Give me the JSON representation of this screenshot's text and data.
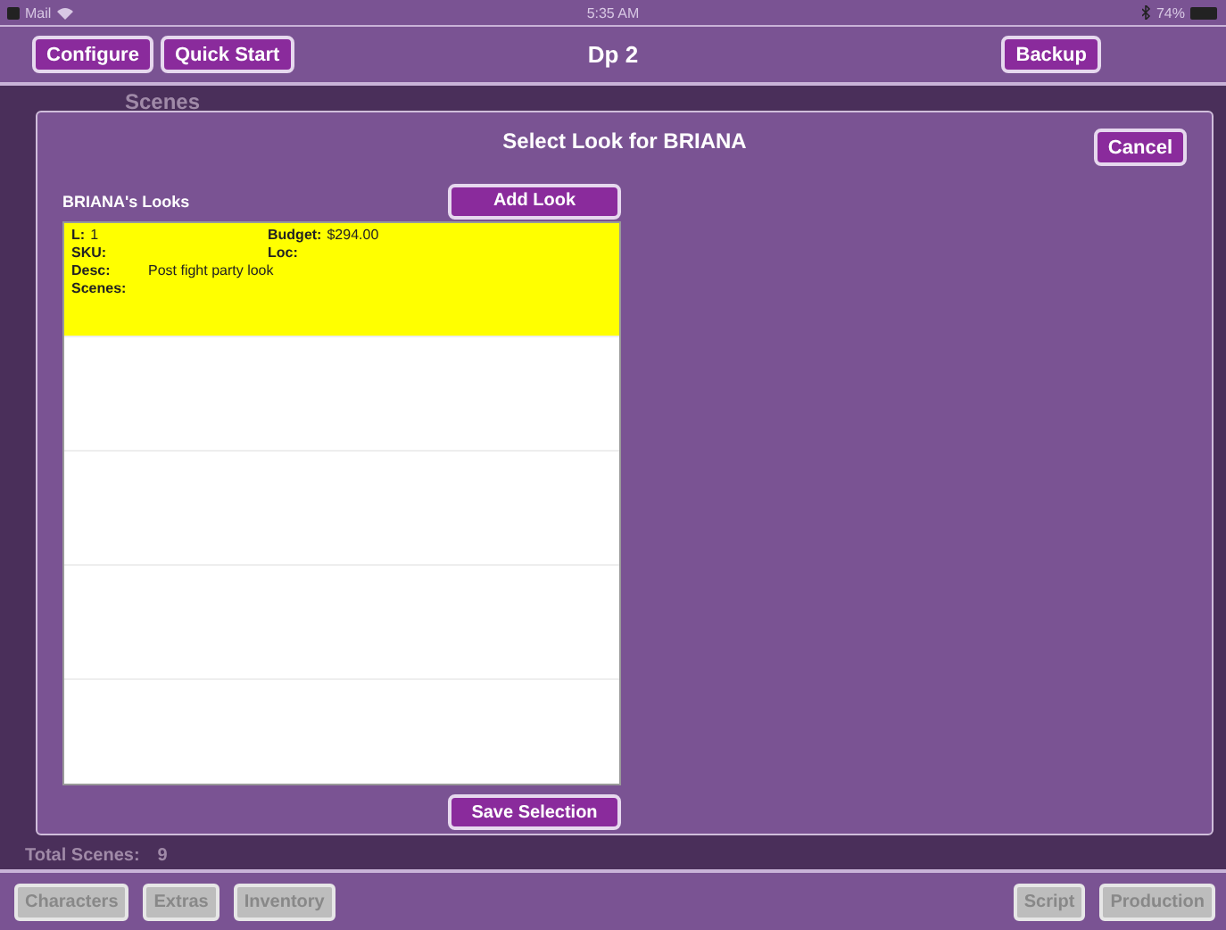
{
  "status_bar": {
    "carrier": "Mail",
    "time": "5:35 AM",
    "battery": "74%"
  },
  "nav_bar": {
    "title": "Dp 2",
    "left_buttons": [
      "Configure",
      "Quick Start"
    ],
    "right_button": "Backup"
  },
  "background": {
    "header": "Scenes",
    "total_label": "Total Scenes:",
    "total_value": "9"
  },
  "dialog": {
    "title": "Select Look for BRIANA",
    "cancel": "Cancel",
    "list_title": "BRIANA's Looks",
    "add_button": "Add Look",
    "save_button": "Save Selection",
    "looks": [
      {
        "selected": true,
        "fields": [
          {
            "label": "L:",
            "value": "1"
          },
          {
            "label": "Budget:",
            "value": "$294.00"
          },
          {
            "label": "SKU:"
          },
          {
            "label": "Loc:"
          },
          {
            "label": "Desc:",
            "value": "Post fight party look"
          },
          {
            "label": "Scenes:"
          }
        ]
      }
    ]
  },
  "toolbar": {
    "left": [
      {
        "label": "Characters",
        "disabled": true
      },
      {
        "label": "Extras",
        "disabled": true
      },
      {
        "label": "Inventory",
        "disabled": true
      }
    ],
    "right": [
      {
        "label": "Script",
        "disabled": true
      },
      {
        "label": "Production",
        "disabled": true
      }
    ]
  }
}
